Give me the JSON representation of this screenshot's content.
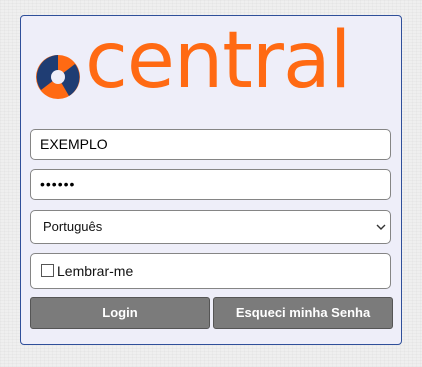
{
  "brand": {
    "wordmark": "central",
    "orange": "#ff6a13",
    "navy": "#1f3d73",
    "icon": "central-logo-icon"
  },
  "login_form": {
    "username_value": "EXEMPLO",
    "password_value": "••••••",
    "language_selected": "Português",
    "remember_label": "Lembrar-me",
    "remember_checked": false,
    "login_button_label": "Login",
    "forgot_button_label": "Esqueci minha Senha"
  },
  "colors": {
    "panel_background": "#eeeef9",
    "panel_border": "#2f4f9a",
    "button_background": "#7b7b7b"
  }
}
